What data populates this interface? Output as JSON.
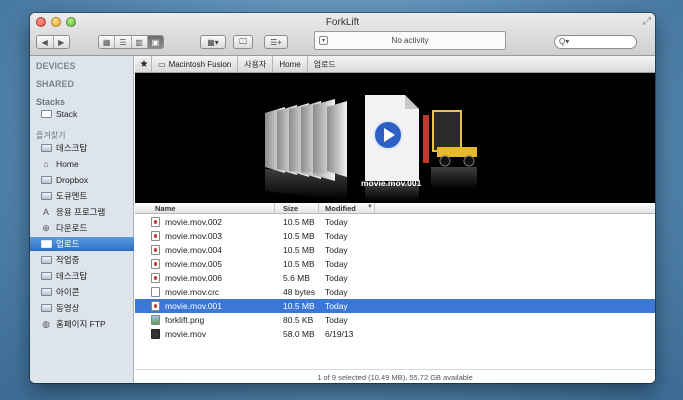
{
  "window": {
    "title": "ForkLift"
  },
  "toolbar": {
    "back": "◀",
    "forward": "▶",
    "activity_text": "No activity",
    "search_placeholder": "Q▾"
  },
  "sidebar": {
    "sections": {
      "devices": "DEVICES",
      "shared": "SHARED",
      "stacks": "Stacks",
      "favorites": "즐겨찾기"
    },
    "stack_item": "Stack",
    "items": [
      {
        "label": "데스크탑",
        "icon": "folder-icon"
      },
      {
        "label": "Home",
        "icon": "home-icon"
      },
      {
        "label": "Dropbox",
        "icon": "folder-icon"
      },
      {
        "label": "도큐멘트",
        "icon": "folder-icon"
      },
      {
        "label": "응용 프로그램",
        "icon": "applications-icon"
      },
      {
        "label": "다운로드",
        "icon": "download-icon"
      },
      {
        "label": "업로드",
        "icon": "folder-icon"
      },
      {
        "label": "작업중",
        "icon": "folder-icon"
      },
      {
        "label": "데스크탑",
        "icon": "folder-icon"
      },
      {
        "label": "아이콘",
        "icon": "folder-icon"
      },
      {
        "label": "동영상",
        "icon": "folder-icon"
      },
      {
        "label": "홈페이지 FTP",
        "icon": "globe-icon"
      }
    ],
    "selected_index": 6
  },
  "pathbar": {
    "star": "★",
    "segments": [
      "Macintosh Fusion",
      "사용자",
      "Home",
      "업로드"
    ]
  },
  "preview": {
    "caption": "movie.mov.001"
  },
  "columns": {
    "name": "Name",
    "size": "Size",
    "modified": "Modified"
  },
  "files": [
    {
      "name": "movie.mov.002",
      "size": "10.5 MB",
      "modified": "Today",
      "icon": "mov"
    },
    {
      "name": "movie.mov.003",
      "size": "10.5 MB",
      "modified": "Today",
      "icon": "mov"
    },
    {
      "name": "movie.mov.004",
      "size": "10.5 MB",
      "modified": "Today",
      "icon": "mov"
    },
    {
      "name": "movie.mov.005",
      "size": "10.5 MB",
      "modified": "Today",
      "icon": "mov"
    },
    {
      "name": "movie.mov.006",
      "size": "5.6 MB",
      "modified": "Today",
      "icon": "mov"
    },
    {
      "name": "movie.mov.crc",
      "size": "48 bytes",
      "modified": "Today",
      "icon": "doc"
    },
    {
      "name": "movie.mov.001",
      "size": "10.5 MB",
      "modified": "Today",
      "icon": "mov",
      "selected": true
    },
    {
      "name": "forklift.png",
      "size": "80.5 KB",
      "modified": "Today",
      "icon": "img"
    },
    {
      "name": "movie.mov",
      "size": "58.0 MB",
      "modified": "6/19/13",
      "icon": "film"
    }
  ],
  "status": "1 of 9 selected  (10.49 MB), 55.72 GB available",
  "colors": {
    "selection": "#3a77d6",
    "sidebar_bg": "#dde4ec"
  }
}
